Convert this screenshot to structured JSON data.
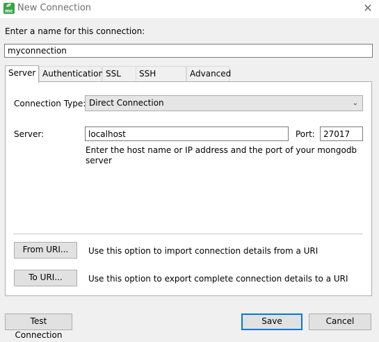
{
  "window": {
    "title": "New Connection",
    "icon": "mongo-leaf-icon",
    "app_icon_text": "mc"
  },
  "name_section": {
    "label": "Enter a name for this connection:",
    "value": "myconnection"
  },
  "tabs": [
    {
      "label": "Server",
      "active": true
    },
    {
      "label": "Authentication",
      "active": false
    },
    {
      "label": "SSL",
      "active": false
    },
    {
      "label": "SSH Tunnel",
      "active": false
    },
    {
      "label": "Advanced",
      "active": false
    }
  ],
  "server_tab": {
    "connection_type_label": "Connection Type:",
    "connection_type_value": "Direct Connection",
    "server_label": "Server:",
    "server_value": "localhost",
    "port_label": "Port:",
    "port_value": "27017",
    "hint": "Enter the host name or IP address and the port of your mongodb server"
  },
  "uri": {
    "from_button": "From URI...",
    "from_text": "Use this option to import connection details from a URI",
    "to_button": "To URI...",
    "to_text": "Use this option to export complete connection details to a URI"
  },
  "footer": {
    "test_button": "Test Connection",
    "save_button": "Save",
    "cancel_button": "Cancel"
  },
  "colors": {
    "window_bg": "#f0f0f0",
    "accent": "#0078d7",
    "icon_green": "#3aa34a"
  }
}
